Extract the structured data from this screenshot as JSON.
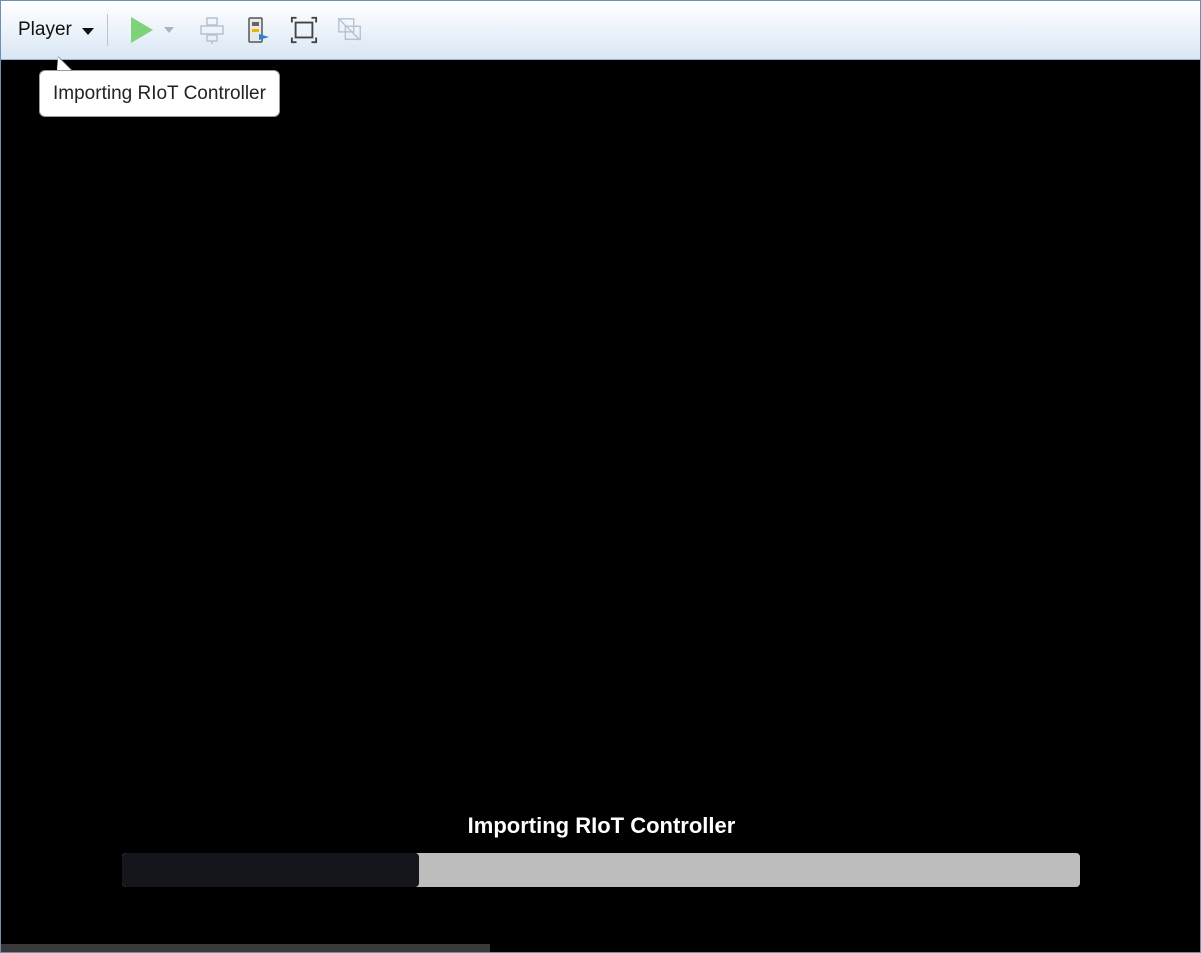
{
  "toolbar": {
    "player_label": "Player",
    "icons": {
      "play": "play-icon",
      "play_dropdown": "chevron-down-icon",
      "send_keys": "send-ctrl-alt-del-icon",
      "removable_devices": "removable-devices-icon",
      "fullscreen": "fullscreen-icon",
      "unity": "unity-icon"
    },
    "colors": {
      "play_green": "#7fd17a",
      "disabled_grey": "#a9b4c0"
    }
  },
  "tooltip": {
    "text": "Importing RIoT Controller"
  },
  "vm_screen": {
    "status_text": "Importing RIoT Controller",
    "progress": 0.31,
    "colors": {
      "background": "#000000",
      "progress_fill": "#15151c",
      "progress_track": "#bdbdbd"
    }
  }
}
